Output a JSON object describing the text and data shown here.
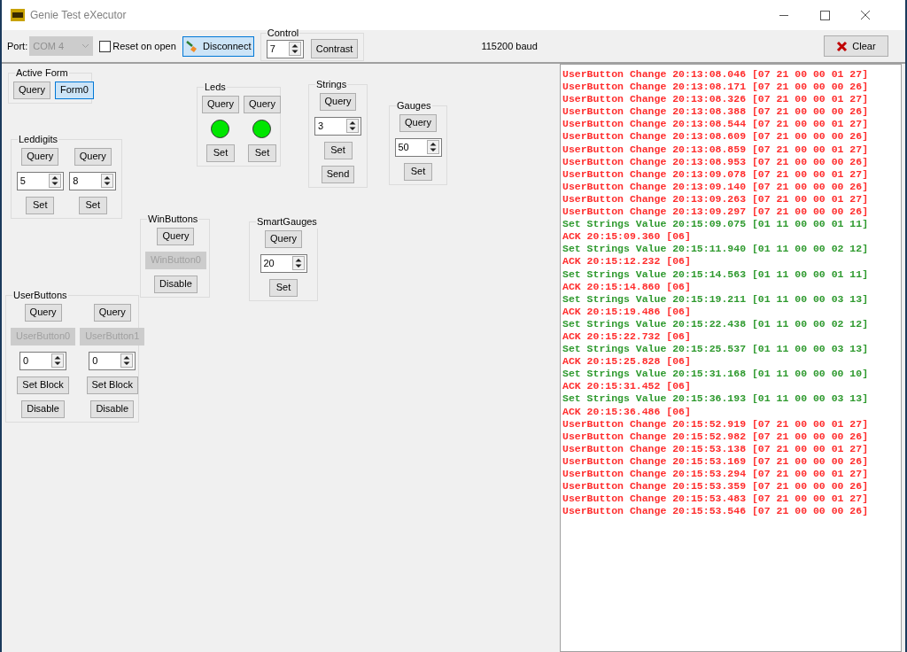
{
  "window": {
    "title": "Genie Test eXecutor"
  },
  "toolbar": {
    "port_label": "Port:",
    "port_value": "COM 4",
    "port_disabled": true,
    "reset_on_open": {
      "label": "Reset on open",
      "checked": false
    },
    "connect_button": {
      "label": "Disconnect",
      "focused": true
    },
    "control": {
      "title": "Control",
      "value": "7",
      "button": "Contrast"
    },
    "baud": "115200 baud",
    "clear_button": "Clear"
  },
  "groups": [
    {
      "title": "Active Form",
      "columns": [
        [
          {
            "kind": "button",
            "label": "Query",
            "focused": false,
            "disabled": false
          }
        ],
        [
          {
            "kind": "button",
            "label": "Form0",
            "focused": true,
            "disabled": false
          }
        ]
      ]
    },
    {
      "title": "Leds",
      "columns": [
        [
          {
            "kind": "button",
            "label": "Query",
            "focused": false,
            "disabled": false
          },
          {
            "kind": "led",
            "on": true
          },
          {
            "kind": "set",
            "label": "Set",
            "focused": false,
            "disabled": false
          }
        ],
        [
          {
            "kind": "button",
            "label": "Query",
            "focused": false,
            "disabled": false
          },
          {
            "kind": "led",
            "on": true
          },
          {
            "kind": "set",
            "label": "Set",
            "focused": false,
            "disabled": false
          }
        ]
      ]
    },
    {
      "title": "Strings",
      "columns": [
        [
          {
            "kind": "button",
            "label": "Query",
            "focused": false,
            "disabled": false
          },
          {
            "kind": "spin",
            "value": "3"
          },
          {
            "kind": "set",
            "label": "Set",
            "focused": false,
            "disabled": false
          },
          {
            "kind": "button",
            "label": "Send",
            "focused": false,
            "disabled": false
          }
        ]
      ]
    },
    {
      "title": "Gauges",
      "columns": [
        [
          {
            "kind": "button",
            "label": "Query",
            "focused": false,
            "disabled": false
          },
          {
            "kind": "spin",
            "value": "50"
          },
          {
            "kind": "set",
            "label": "Set",
            "focused": false,
            "disabled": false
          }
        ]
      ]
    },
    {
      "title": "Leddigits",
      "columns": [
        [
          {
            "kind": "button",
            "label": "Query",
            "focused": false,
            "disabled": false
          },
          {
            "kind": "spin",
            "value": "5"
          },
          {
            "kind": "set",
            "label": "Set",
            "focused": false,
            "disabled": false
          }
        ],
        [
          {
            "kind": "button",
            "label": "Query",
            "focused": false,
            "disabled": false
          },
          {
            "kind": "spin",
            "value": "8"
          },
          {
            "kind": "set",
            "label": "Set",
            "focused": false,
            "disabled": false
          }
        ]
      ]
    },
    {
      "title": "WinButtons",
      "columns": [
        [
          {
            "kind": "button",
            "label": "Query",
            "focused": false,
            "disabled": false
          },
          {
            "kind": "button",
            "label": "WinButton0",
            "focused": false,
            "disabled": true
          },
          {
            "kind": "button",
            "label": "Disable",
            "focused": false,
            "disabled": false
          }
        ]
      ]
    },
    {
      "title": "SmartGauges",
      "columns": [
        [
          {
            "kind": "button",
            "label": "Query",
            "focused": false,
            "disabled": false
          },
          {
            "kind": "spin",
            "value": "20"
          },
          {
            "kind": "set",
            "label": "Set",
            "focused": false,
            "disabled": false
          }
        ]
      ]
    },
    {
      "title": "UserButtons",
      "columns": [
        [
          {
            "kind": "button",
            "label": "Query",
            "focused": false,
            "disabled": false
          },
          {
            "kind": "button",
            "label": "UserButton0",
            "focused": false,
            "disabled": true
          },
          {
            "kind": "spin",
            "value": "0"
          },
          {
            "kind": "button",
            "label": "Set Block",
            "focused": false,
            "disabled": false
          },
          {
            "kind": "button",
            "label": "Disable",
            "focused": false,
            "disabled": false
          }
        ],
        [
          {
            "kind": "button",
            "label": "Query",
            "focused": false,
            "disabled": false
          },
          {
            "kind": "button",
            "label": "UserButton1",
            "focused": false,
            "disabled": true
          },
          {
            "kind": "spin",
            "value": "0"
          },
          {
            "kind": "button",
            "label": "Set Block",
            "focused": false,
            "disabled": false
          },
          {
            "kind": "button",
            "label": "Disable",
            "focused": false,
            "disabled": false
          }
        ]
      ]
    }
  ],
  "log": [
    {
      "kind": "event",
      "text": "UserButton Change 20:13:08.046 [07 21 00 00 01 27]"
    },
    {
      "kind": "event",
      "text": "UserButton Change 20:13:08.171 [07 21 00 00 00 26]"
    },
    {
      "kind": "event",
      "text": "UserButton Change 20:13:08.326 [07 21 00 00 01 27]"
    },
    {
      "kind": "event",
      "text": "UserButton Change 20:13:08.388 [07 21 00 00 00 26]"
    },
    {
      "kind": "event",
      "text": "UserButton Change 20:13:08.544 [07 21 00 00 01 27]"
    },
    {
      "kind": "event",
      "text": "UserButton Change 20:13:08.609 [07 21 00 00 00 26]"
    },
    {
      "kind": "event",
      "text": "UserButton Change 20:13:08.859 [07 21 00 00 01 27]"
    },
    {
      "kind": "event",
      "text": "UserButton Change 20:13:08.953 [07 21 00 00 00 26]"
    },
    {
      "kind": "event",
      "text": "UserButton Change 20:13:09.078 [07 21 00 00 01 27]"
    },
    {
      "kind": "event",
      "text": "UserButton Change 20:13:09.140 [07 21 00 00 00 26]"
    },
    {
      "kind": "event",
      "text": "UserButton Change 20:13:09.263 [07 21 00 00 01 27]"
    },
    {
      "kind": "event",
      "text": "UserButton Change 20:13:09.297 [07 21 00 00 00 26]"
    },
    {
      "kind": "command",
      "text": "Set Strings Value 20:15:09.075 [01 11 00 00 01 11]"
    },
    {
      "kind": "ack",
      "text": "ACK 20:15:09.360 [06]"
    },
    {
      "kind": "command",
      "text": "Set Strings Value 20:15:11.940 [01 11 00 00 02 12]"
    },
    {
      "kind": "ack",
      "text": "ACK 20:15:12.232 [06]"
    },
    {
      "kind": "command",
      "text": "Set Strings Value 20:15:14.563 [01 11 00 00 01 11]"
    },
    {
      "kind": "ack",
      "text": "ACK 20:15:14.860 [06]"
    },
    {
      "kind": "command",
      "text": "Set Strings Value 20:15:19.211 [01 11 00 00 03 13]"
    },
    {
      "kind": "ack",
      "text": "ACK 20:15:19.486 [06]"
    },
    {
      "kind": "command",
      "text": "Set Strings Value 20:15:22.438 [01 11 00 00 02 12]"
    },
    {
      "kind": "ack",
      "text": "ACK 20:15:22.732 [06]"
    },
    {
      "kind": "command",
      "text": "Set Strings Value 20:15:25.537 [01 11 00 00 03 13]"
    },
    {
      "kind": "ack",
      "text": "ACK 20:15:25.828 [06]"
    },
    {
      "kind": "command",
      "text": "Set Strings Value 20:15:31.168 [01 11 00 00 00 10]"
    },
    {
      "kind": "ack",
      "text": "ACK 20:15:31.452 [06]"
    },
    {
      "kind": "command",
      "text": "Set Strings Value 20:15:36.193 [01 11 00 00 03 13]"
    },
    {
      "kind": "ack",
      "text": "ACK 20:15:36.486 [06]"
    },
    {
      "kind": "event",
      "text": "UserButton Change 20:15:52.919 [07 21 00 00 01 27]"
    },
    {
      "kind": "event",
      "text": "UserButton Change 20:15:52.982 [07 21 00 00 00 26]"
    },
    {
      "kind": "event",
      "text": "UserButton Change 20:15:53.138 [07 21 00 00 01 27]"
    },
    {
      "kind": "event",
      "text": "UserButton Change 20:15:53.169 [07 21 00 00 00 26]"
    },
    {
      "kind": "event",
      "text": "UserButton Change 20:15:53.294 [07 21 00 00 01 27]"
    },
    {
      "kind": "event",
      "text": "UserButton Change 20:15:53.359 [07 21 00 00 00 26]"
    },
    {
      "kind": "event",
      "text": "UserButton Change 20:15:53.483 [07 21 00 00 01 27]"
    },
    {
      "kind": "event",
      "text": "UserButton Change 20:15:53.546 [07 21 00 00 00 26]"
    }
  ]
}
